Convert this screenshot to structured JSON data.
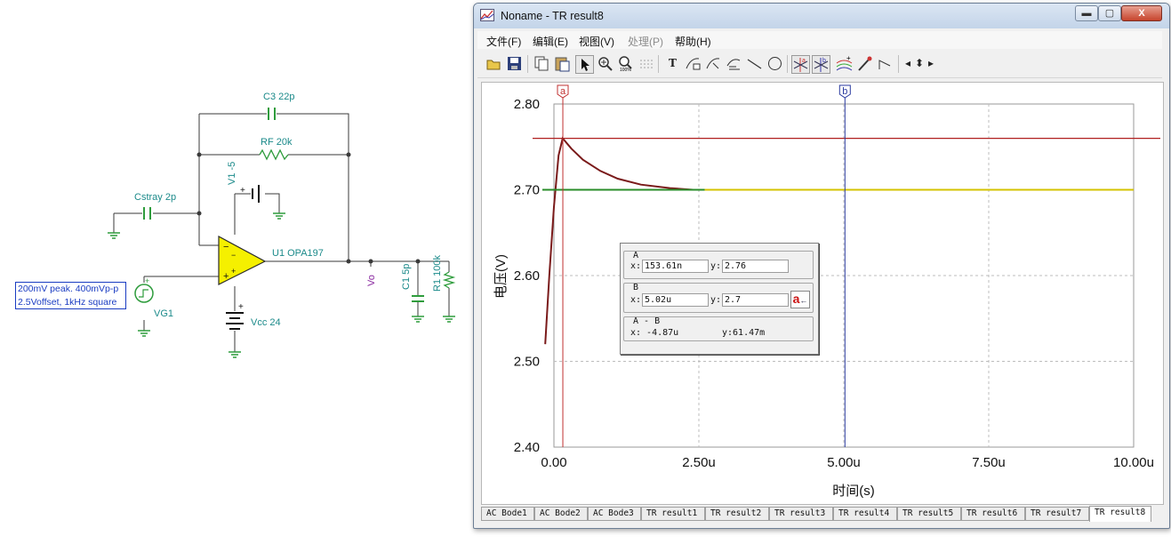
{
  "schematic": {
    "components": {
      "c3": "C3 22p",
      "rf": "RF 20k",
      "v1": "V1 -5",
      "cstray": "Cstray 2p",
      "u1": "U1 OPA197",
      "vo": "Vo",
      "c1": "C1 5p",
      "r1": "R1 100k",
      "vcc": "Vcc 24",
      "vg1": "VG1"
    },
    "source_note": [
      "200mV peak. 400mVp-p",
      "2.5Voffset, 1kHz square"
    ]
  },
  "window": {
    "title": "Noname - TR result8",
    "caption_buttons": {
      "min": "▬",
      "max": "▢",
      "close": "X"
    }
  },
  "menu": [
    {
      "label": "文件(F)",
      "enabled": true
    },
    {
      "label": "编辑(E)",
      "enabled": true
    },
    {
      "label": "视图(V)",
      "enabled": true
    },
    {
      "label": "处理(P)",
      "enabled": false
    },
    {
      "label": "帮助(H)",
      "enabled": true
    }
  ],
  "toolbar_icons": [
    "open-icon",
    "save-icon",
    "copy-icon",
    "paste-icon",
    "pointer-icon",
    "zoom-in-icon",
    "zoom-100-icon",
    "grid-icon",
    "text-icon",
    "curve-label-icon",
    "curve-label2-icon",
    "axis-label-icon",
    "line-icon",
    "circle-icon",
    "cursor-a-icon",
    "cursor-b-icon",
    "add-trace-icon",
    "probe-icon",
    "step-icon",
    "left-arrow-icon",
    "up-down-arrow-icon",
    "right-arrow-icon"
  ],
  "chart_data": {
    "type": "line",
    "xlabel": "时间(s)",
    "ylabel": "电压(V)",
    "xlim": [
      0,
      1e-05
    ],
    "ylim": [
      2.4,
      2.8
    ],
    "x_ticks": [
      "0.00",
      "2.50u",
      "5.00u",
      "7.50u",
      "10.00u"
    ],
    "y_ticks": [
      "2.80",
      "2.70",
      "2.60",
      "2.50",
      "2.40"
    ],
    "grid": true,
    "series": [
      {
        "color": "#7a1a1a",
        "points": [
          [
            -1.5e-07,
            2.52
          ],
          [
            -8e-08,
            2.6
          ],
          [
            0.0,
            2.68
          ],
          [
            8e-08,
            2.74
          ],
          [
            1.5e-07,
            2.76
          ],
          [
            3e-07,
            2.748
          ],
          [
            5e-07,
            2.735
          ],
          [
            8e-07,
            2.722
          ],
          [
            1.1e-06,
            2.713
          ],
          [
            1.5e-06,
            2.706
          ],
          [
            2e-06,
            2.702
          ],
          [
            2.4e-06,
            2.7
          ]
        ]
      },
      {
        "color": "#2a8c2a",
        "points": [
          [
            -2e-07,
            2.7
          ],
          [
            1e-05,
            2.7
          ]
        ]
      },
      {
        "color": "#d4c300",
        "points": [
          [
            2.6e-06,
            2.7
          ],
          [
            1e-05,
            2.7
          ]
        ]
      }
    ],
    "hlines": [
      {
        "y": 2.76,
        "color": "#b02020"
      }
    ],
    "cursors": [
      {
        "label": "a",
        "x": 1.5361e-07,
        "color": "#c03030"
      },
      {
        "label": "b",
        "x": 5.02e-06,
        "color": "#2a3aa0"
      }
    ]
  },
  "cursor_dialog": {
    "a": {
      "title": "A",
      "x_label": "x:",
      "x": "153.61n",
      "y_label": "y:",
      "y": "2.76"
    },
    "b": {
      "title": "B",
      "x_label": "x:",
      "x": "5.02u",
      "y_label": "y:",
      "y": "2.7",
      "button": "a"
    },
    "diff": {
      "title": "A - B",
      "x": "x: -4.87u",
      "y": "y:61.47m"
    }
  },
  "tabs": [
    "AC Bode1",
    "AC Bode2",
    "AC Bode3",
    "TR result1",
    "TR result2",
    "TR result3",
    "TR result4",
    "TR result5",
    "TR result6",
    "TR result7",
    "TR result8"
  ],
  "active_tab": "TR result8"
}
